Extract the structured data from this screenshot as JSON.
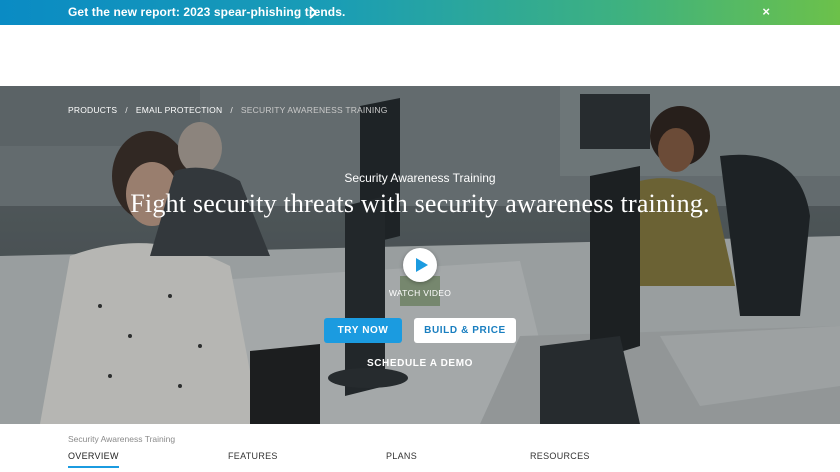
{
  "banner": {
    "text": "Get the new report: 2023 spear-phishing trends.",
    "close_glyph": "×",
    "chevron_icon": "chevron-right-icon",
    "close_icon": "close-icon"
  },
  "hero": {
    "breadcrumb": {
      "items": [
        "PRODUCTS",
        "EMAIL PROTECTION",
        "SECURITY AWARENESS TRAINING"
      ],
      "separator": "/"
    },
    "eyebrow": "Security Awareness Training",
    "headline": "Fight security threats with security awareness training.",
    "watch_video_label": "WATCH VIDEO",
    "play_icon": "play-icon",
    "buttons": {
      "try_now": "TRY NOW",
      "build_price": "BUILD & PRICE"
    },
    "schedule_demo": "SCHEDULE A DEMO"
  },
  "subnav": {
    "title": "Security Awareness Training",
    "items": [
      "OVERVIEW",
      "FEATURES",
      "PLANS",
      "RESOURCES"
    ],
    "active_index": 0
  },
  "colors": {
    "accent": "#1b9be0",
    "banner_start": "#0a8bc4",
    "banner_end": "#6cc14a"
  }
}
